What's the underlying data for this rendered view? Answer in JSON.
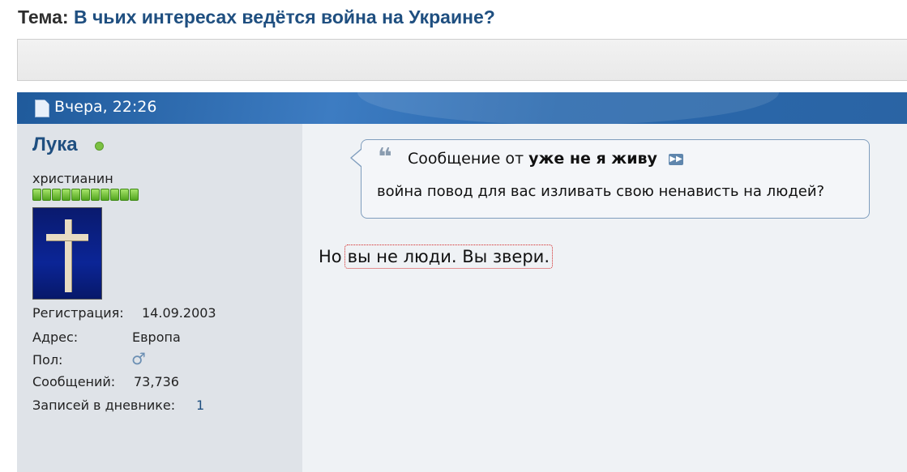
{
  "thread": {
    "prefix": "Тема:",
    "title": "В чьих интересах ведётся война на Украине?"
  },
  "post": {
    "date": "Вчера, 22:26",
    "user": {
      "name": "Лука",
      "title": "христианин",
      "reputation_pips": 11,
      "fields": {
        "registration_label": "Регистрация:",
        "registration_value": "14.09.2003",
        "address_label": "Адрес:",
        "address_value": "Европа",
        "gender_label": "Пол:",
        "gender_value": "♂",
        "posts_label": "Сообщений:",
        "posts_value": "73,736",
        "diary_label": "Записей в дневнике:",
        "diary_value": "1"
      }
    },
    "quote": {
      "intro": "Сообщение от",
      "author": "уже не я живу",
      "text": "война повод для вас изливать свою ненависть на людей?"
    },
    "message": {
      "start": "Но",
      "highlighted": "вы не люди. Вы звери."
    }
  },
  "colors": {
    "link": "#1f4f80",
    "header_bar": "#2a64a4",
    "online": "#7bc142",
    "reputation": "#52a51f",
    "highlight_border": "#d42a2a"
  },
  "icons": {
    "post": "document-icon",
    "online": "online-status-icon",
    "quote": "quote-icon",
    "view_post": "view-post-icon",
    "gender": "male-icon"
  }
}
